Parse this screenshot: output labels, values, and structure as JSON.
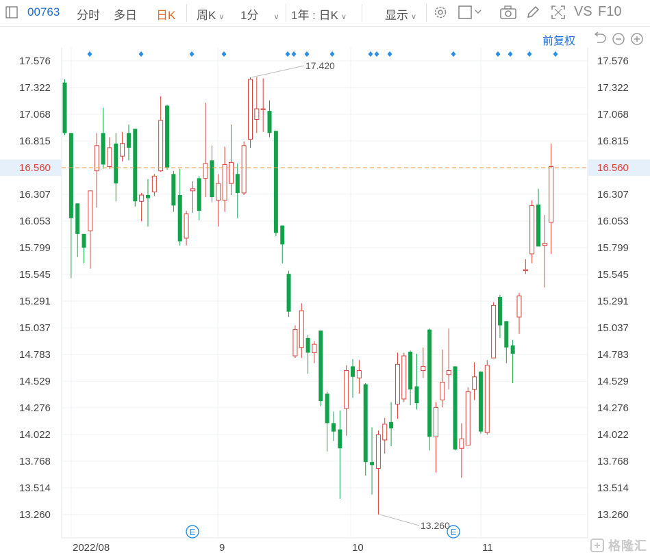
{
  "toolbar": {
    "code": "00763",
    "tabs": [
      "分时",
      "多日",
      "日K",
      "周K",
      "1分",
      "1年 : 日K"
    ],
    "active_tab": "日K",
    "display_label": "显示",
    "vs_label": "VS",
    "f10_label": "F10"
  },
  "subbar": {
    "adjust_label": "前复权"
  },
  "watermark": "格隆汇",
  "colors": {
    "up": "#d9403a",
    "down": "#12a24a",
    "price_line": "#f0a050",
    "price_tag_bg": "#e6f0fb",
    "marker": "#2a8fe6"
  },
  "chart_data": {
    "type": "candlestick",
    "y_ticks": [
      "17.576",
      "17.322",
      "17.068",
      "16.815",
      "16.560",
      "16.307",
      "16.053",
      "15.799",
      "15.545",
      "15.291",
      "15.037",
      "14.783",
      "14.529",
      "14.276",
      "14.022",
      "13.768",
      "13.514",
      "13.260"
    ],
    "ylim": [
      13.26,
      17.576
    ],
    "x_labels": [
      "2022/08",
      "9",
      "10",
      "11"
    ],
    "current_price": "16.560",
    "max_label": "17.420",
    "min_label": "13.260",
    "event_label": "E",
    "candles": [
      {
        "o": 17.37,
        "h": 17.4,
        "l": 16.87,
        "c": 16.89
      },
      {
        "o": 16.89,
        "h": 16.89,
        "l": 15.51,
        "c": 16.08
      },
      {
        "o": 16.22,
        "h": 16.22,
        "l": 15.71,
        "c": 15.93
      },
      {
        "o": 15.93,
        "h": 15.93,
        "l": 15.65,
        "c": 15.8
      },
      {
        "o": 15.96,
        "h": 16.33,
        "l": 15.6,
        "c": 16.34
      },
      {
        "o": 16.53,
        "h": 16.89,
        "l": 16.18,
        "c": 16.77
      },
      {
        "o": 16.89,
        "h": 17.13,
        "l": 16.55,
        "c": 16.59
      },
      {
        "o": 16.57,
        "h": 16.85,
        "l": 16.55,
        "c": 16.75
      },
      {
        "o": 16.79,
        "h": 16.89,
        "l": 16.24,
        "c": 16.41
      },
      {
        "o": 16.67,
        "h": 16.9,
        "l": 16.62,
        "c": 16.79
      },
      {
        "o": 16.89,
        "h": 16.97,
        "l": 16.63,
        "c": 16.75
      },
      {
        "o": 16.93,
        "h": 16.93,
        "l": 16.19,
        "c": 16.24
      },
      {
        "o": 16.24,
        "h": 16.32,
        "l": 16.05,
        "c": 16.3
      },
      {
        "o": 16.3,
        "h": 16.45,
        "l": 16.0,
        "c": 16.27
      },
      {
        "o": 16.33,
        "h": 16.5,
        "l": 16.29,
        "c": 16.48
      },
      {
        "o": 16.53,
        "h": 17.24,
        "l": 16.52,
        "c": 17.01
      },
      {
        "o": 17.15,
        "h": 17.16,
        "l": 16.54,
        "c": 16.56
      },
      {
        "o": 16.5,
        "h": 16.53,
        "l": 16.14,
        "c": 16.2
      },
      {
        "o": 16.3,
        "h": 16.55,
        "l": 15.82,
        "c": 15.86
      },
      {
        "o": 15.89,
        "h": 16.15,
        "l": 15.82,
        "c": 16.12
      },
      {
        "o": 16.34,
        "h": 16.43,
        "l": 16.13,
        "c": 16.36
      },
      {
        "o": 16.46,
        "h": 16.48,
        "l": 16.06,
        "c": 16.15
      },
      {
        "o": 16.46,
        "h": 17.18,
        "l": 16.28,
        "c": 16.6
      },
      {
        "o": 16.63,
        "h": 16.77,
        "l": 16.23,
        "c": 16.28
      },
      {
        "o": 16.25,
        "h": 16.5,
        "l": 16.0,
        "c": 16.41
      },
      {
        "o": 16.25,
        "h": 16.76,
        "l": 16.14,
        "c": 16.59
      },
      {
        "o": 16.41,
        "h": 16.97,
        "l": 16.3,
        "c": 16.61
      },
      {
        "o": 16.5,
        "h": 16.6,
        "l": 16.08,
        "c": 16.32
      },
      {
        "o": 16.32,
        "h": 16.81,
        "l": 16.3,
        "c": 16.77
      },
      {
        "o": 16.83,
        "h": 17.42,
        "l": 16.75,
        "c": 17.4
      },
      {
        "o": 17.02,
        "h": 17.42,
        "l": 16.89,
        "c": 17.12
      },
      {
        "o": 17.12,
        "h": 17.41,
        "l": 16.9,
        "c": 17.12
      },
      {
        "o": 17.1,
        "h": 17.2,
        "l": 16.85,
        "c": 16.89
      },
      {
        "o": 16.91,
        "h": 16.91,
        "l": 15.91,
        "c": 15.94
      },
      {
        "o": 16.01,
        "h": 16.01,
        "l": 15.65,
        "c": 15.83
      },
      {
        "o": 15.55,
        "h": 15.58,
        "l": 15.14,
        "c": 15.19
      },
      {
        "o": 14.77,
        "h": 15.06,
        "l": 14.75,
        "c": 15.02
      },
      {
        "o": 14.85,
        "h": 15.27,
        "l": 14.75,
        "c": 15.2
      },
      {
        "o": 14.94,
        "h": 14.97,
        "l": 14.6,
        "c": 14.8
      },
      {
        "o": 14.8,
        "h": 14.91,
        "l": 14.7,
        "c": 14.88
      },
      {
        "o": 15.01,
        "h": 15.01,
        "l": 14.29,
        "c": 14.34
      },
      {
        "o": 14.41,
        "h": 14.43,
        "l": 13.86,
        "c": 14.13
      },
      {
        "o": 14.13,
        "h": 14.24,
        "l": 13.96,
        "c": 14.05
      },
      {
        "o": 14.07,
        "h": 14.25,
        "l": 13.41,
        "c": 13.89
      },
      {
        "o": 14.27,
        "h": 14.68,
        "l": 14.01,
        "c": 14.63
      },
      {
        "o": 14.67,
        "h": 14.74,
        "l": 14.37,
        "c": 14.57
      },
      {
        "o": 14.56,
        "h": 14.73,
        "l": 14.41,
        "c": 14.63
      },
      {
        "o": 14.5,
        "h": 14.51,
        "l": 13.63,
        "c": 13.76
      },
      {
        "o": 13.76,
        "h": 14.09,
        "l": 13.45,
        "c": 13.73
      },
      {
        "o": 13.7,
        "h": 14.06,
        "l": 13.26,
        "c": 14.02
      },
      {
        "o": 13.97,
        "h": 14.18,
        "l": 13.84,
        "c": 14.12
      },
      {
        "o": 14.14,
        "h": 14.33,
        "l": 13.91,
        "c": 14.08
      },
      {
        "o": 14.31,
        "h": 14.8,
        "l": 14.17,
        "c": 14.69
      },
      {
        "o": 14.36,
        "h": 14.8,
        "l": 14.33,
        "c": 14.77
      },
      {
        "o": 14.81,
        "h": 14.82,
        "l": 14.3,
        "c": 14.45
      },
      {
        "o": 14.48,
        "h": 14.79,
        "l": 14.26,
        "c": 14.32
      },
      {
        "o": 14.63,
        "h": 14.85,
        "l": 14.56,
        "c": 14.67
      },
      {
        "o": 15.02,
        "h": 15.03,
        "l": 13.87,
        "c": 14.0
      },
      {
        "o": 14.0,
        "h": 14.33,
        "l": 13.66,
        "c": 14.28
      },
      {
        "o": 14.35,
        "h": 14.83,
        "l": 14.28,
        "c": 14.52
      },
      {
        "o": 14.59,
        "h": 15.03,
        "l": 14.45,
        "c": 14.63
      },
      {
        "o": 14.67,
        "h": 14.67,
        "l": 13.87,
        "c": 13.88
      },
      {
        "o": 13.89,
        "h": 14.13,
        "l": 13.61,
        "c": 13.98
      },
      {
        "o": 13.92,
        "h": 14.47,
        "l": 13.92,
        "c": 14.43
      },
      {
        "o": 14.45,
        "h": 14.71,
        "l": 14.35,
        "c": 14.57
      },
      {
        "o": 14.62,
        "h": 14.62,
        "l": 14.03,
        "c": 14.05
      },
      {
        "o": 14.04,
        "h": 14.73,
        "l": 14.02,
        "c": 14.68
      },
      {
        "o": 14.75,
        "h": 15.28,
        "l": 14.76,
        "c": 15.25
      },
      {
        "o": 15.33,
        "h": 15.35,
        "l": 14.94,
        "c": 15.06
      },
      {
        "o": 15.1,
        "h": 15.1,
        "l": 14.7,
        "c": 14.85
      },
      {
        "o": 14.87,
        "h": 14.92,
        "l": 14.51,
        "c": 14.79
      },
      {
        "o": 15.14,
        "h": 15.37,
        "l": 14.98,
        "c": 15.34
      },
      {
        "o": 15.58,
        "h": 15.69,
        "l": 15.55,
        "c": 15.59
      },
      {
        "o": 15.74,
        "h": 16.25,
        "l": 15.65,
        "c": 16.2
      },
      {
        "o": 16.21,
        "h": 16.36,
        "l": 15.82,
        "c": 15.81
      },
      {
        "o": 15.82,
        "h": 16.11,
        "l": 15.42,
        "c": 15.84
      },
      {
        "o": 16.04,
        "h": 16.79,
        "l": 15.74,
        "c": 16.57
      }
    ]
  }
}
